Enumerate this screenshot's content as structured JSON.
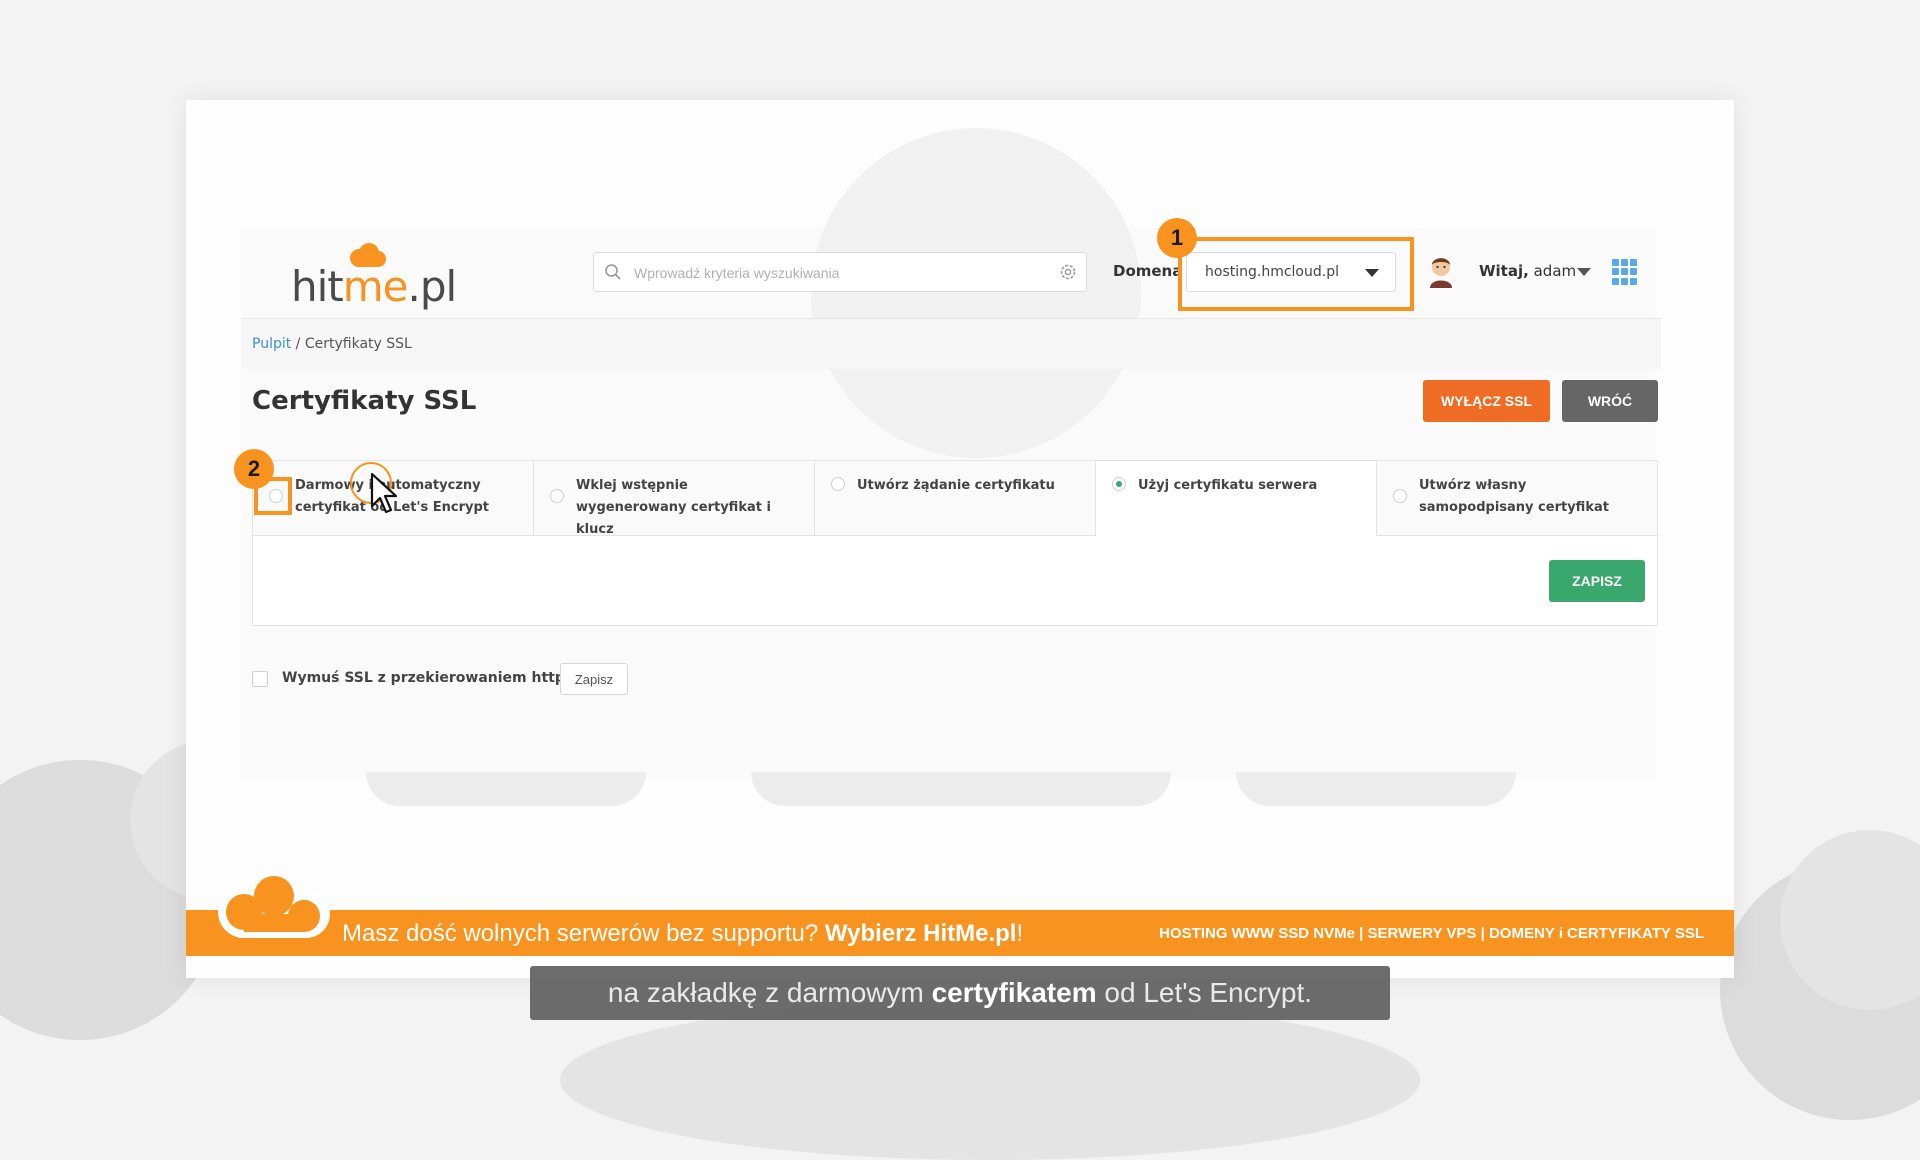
{
  "header": {
    "logo": {
      "part1": "hit",
      "part2": "me",
      "part3": ".pl"
    },
    "search": {
      "placeholder": "Wprowadź kryteria wyszukiwania"
    },
    "domain": {
      "label": "Domena",
      "value": "hosting.hmcloud.pl"
    },
    "greeting": {
      "prefix": "Witaj,",
      "user": "adam"
    }
  },
  "annotations": {
    "step1": "1",
    "step2": "2"
  },
  "breadcrumb": {
    "root": "Pulpit",
    "separator": " / ",
    "current": "Certyfikaty SSL"
  },
  "page": {
    "title": "Certyfikaty SSL",
    "disable_ssl_button": "WYŁĄCZ SSL",
    "back_button": "WRÓĆ"
  },
  "tabs": [
    {
      "label": "Darmowy i automatyczny certyfikat od Let's Encrypt",
      "selected": false
    },
    {
      "label": "Wklej wstępnie wygenerowany certyfikat i klucz",
      "selected": false
    },
    {
      "label": "Utwórz żądanie certyfikatu",
      "selected": false
    },
    {
      "label": "Użyj certyfikatu serwera",
      "selected": true
    },
    {
      "label": "Utwórz własny samopodpisany certyfikat",
      "selected": false
    }
  ],
  "panel": {
    "save_button": "ZAPISZ"
  },
  "force_ssl": {
    "label": "Wymuś SSL z przekierowaniem https",
    "checked": false,
    "button": "Zapisz"
  },
  "banner": {
    "text": "Masz dość wolnych serwerów bez supportu?",
    "cta": "Wybierz HitMe.pl",
    "cta_suffix": "!",
    "services": "HOSTING WWW SSD NVMe | SERWERY VPS | DOMENY i CERTYFIKATY SSL"
  },
  "subtitle": {
    "before": "na zakładkę z darmowym ",
    "emphasis": "certyfikatem",
    "after": " od Let's Encrypt."
  },
  "colors": {
    "accent": "#f7931e",
    "primary_orange": "#ee6c24",
    "green": "#3aa76d",
    "link": "#3a8fd6",
    "grey_button": "#666666"
  }
}
